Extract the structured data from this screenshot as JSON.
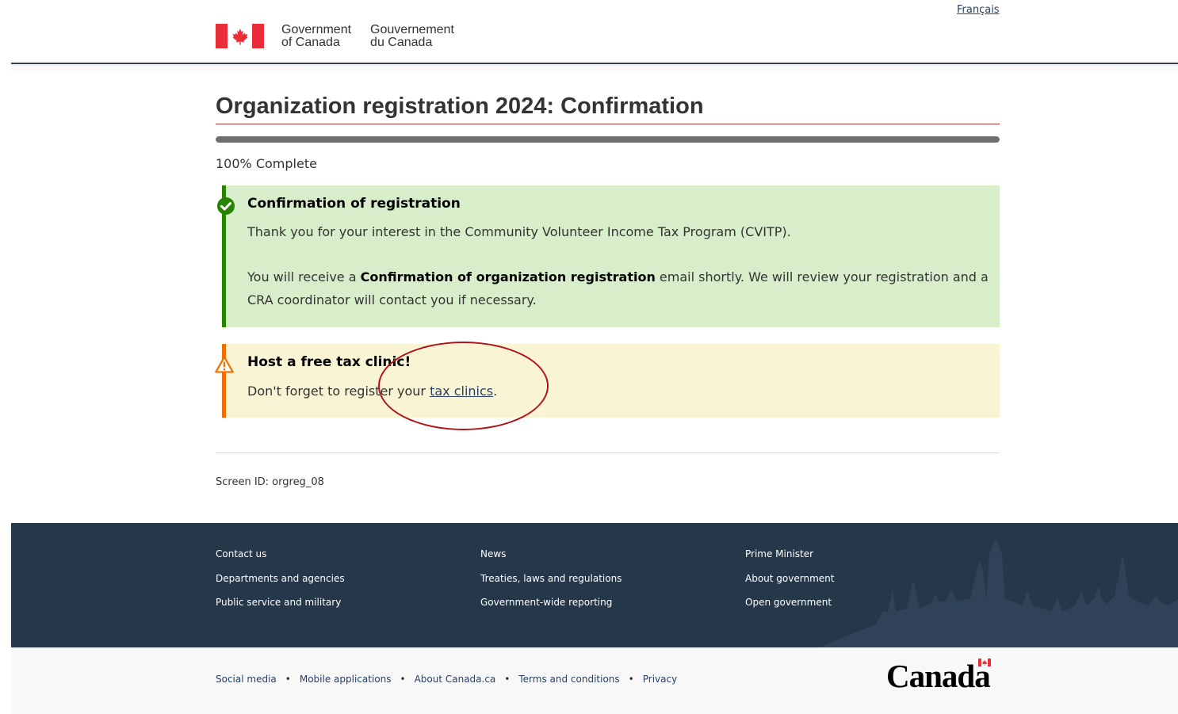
{
  "header": {
    "language_toggle": "Français",
    "gc_en_line1": "Government",
    "gc_en_line2": "of Canada",
    "gc_fr_line1": "Gouvernement",
    "gc_fr_line2": "du Canada"
  },
  "main": {
    "title": "Organization registration 2024: Confirmation",
    "progress_percent": 100,
    "progress_text": "100% Complete",
    "success_alert": {
      "heading": "Confirmation of registration",
      "p1": "Thank you for your interest in the Community Volunteer Income Tax Program (CVITP).",
      "p2_before": "You will receive a ",
      "p2_bold": "Confirmation of organization registration",
      "p2_after": " email shortly. We will review your registration and a CRA coordinator will contact you if necessary.",
      "icon": "check-circle-icon",
      "color": "#278400"
    },
    "warning_alert": {
      "heading": "Host a free tax clinic!",
      "text_before": "Don't forget to register your ",
      "link": "tax clinics",
      "text_after": ".",
      "icon": "warning-triangle-icon",
      "color": "#ee7100"
    },
    "screen_id": "Screen ID: orgreg_08"
  },
  "footer": {
    "col1": [
      "Contact us",
      "Departments and agencies",
      "Public service and military"
    ],
    "col2": [
      "News",
      "Treaties, laws and regulations",
      "Government-wide reporting"
    ],
    "col3": [
      "Prime Minister",
      "About government",
      "Open government"
    ],
    "sub_links": [
      "Social media",
      "Mobile applications",
      "About Canada.ca",
      "Terms and conditions",
      "Privacy"
    ],
    "wordmark": "Canada"
  },
  "colors": {
    "brand_dark": "#26374a",
    "link": "#284162",
    "flag_red": "#eb2d37",
    "title_rule": "#af3c43",
    "annotation": "#b0141b"
  }
}
